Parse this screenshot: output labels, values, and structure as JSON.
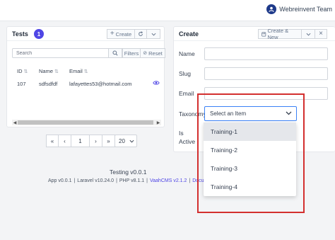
{
  "header": {
    "user_name": "Webreinvent Team",
    "avatar_icon": "user-circle-icon"
  },
  "list": {
    "title": "Tests",
    "count": "1",
    "create_label": "Create",
    "search": {
      "placeholder": "Search",
      "value": ""
    },
    "filters_label": "Filters",
    "reset_label": "Reset",
    "columns": [
      "ID",
      "Name",
      "Email"
    ],
    "rows": [
      {
        "id": "107",
        "name": "sdfsdfdf",
        "email": "lafayettes53@hotmail.com"
      }
    ],
    "pagination": {
      "current_page": "1",
      "per_page": "20"
    }
  },
  "form": {
    "title": "Create",
    "create_new_label": "Create & New",
    "fields": {
      "name": "Name",
      "slug": "Slug",
      "email": "Email",
      "taxonomy": "Taxonomy",
      "is_active_1": "Is",
      "is_active_2": "Active"
    },
    "taxonomy_placeholder": "Select an Item",
    "taxonomy_options": [
      "Training-1",
      "Training-2",
      "Training-3",
      "Training-4"
    ]
  },
  "footer": {
    "title": "Testing v0.0.1",
    "app": "App v0.0.1",
    "laravel": "Laravel v10.24.0",
    "php": "PHP v8.1.1",
    "vaahcms": "VaahCMS v2.1.2",
    "documentation": "Documentation",
    "sep": "|"
  },
  "colors": {
    "accent": "#4f46e5",
    "highlight": "#d32f2f",
    "focus": "#3b82f6"
  }
}
